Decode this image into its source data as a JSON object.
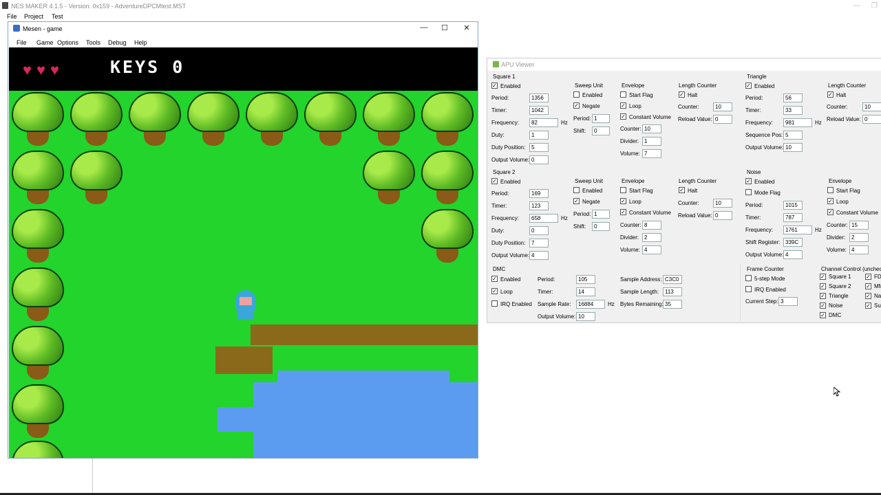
{
  "nesmaker": {
    "title": "NES MAKER 4.1.5 - Version: 0x159 - AdventureDPCMtest.MST",
    "menu": [
      "File",
      "Project",
      "Test"
    ]
  },
  "mesen": {
    "title": "Mesen - game",
    "menu": [
      "File",
      "Game",
      "Options",
      "Tools",
      "Debug",
      "Help"
    ],
    "buttons": {
      "min": "—",
      "max": "☐",
      "close": "✕"
    }
  },
  "game": {
    "hearts": [
      "♥",
      "♥",
      "♥"
    ],
    "keys_text": "KEYS 0"
  },
  "apu": {
    "title": "APU Viewer",
    "sq1": {
      "label": "Square 1",
      "enabled": "Enabled",
      "period_l": "Period:",
      "period": "1356",
      "timer_l": "Timer:",
      "timer": "1042",
      "freq_l": "Frequency:",
      "freq": "82",
      "hz": "Hz",
      "duty_l": "Duty:",
      "duty": "1",
      "dpos_l": "Duty Position:",
      "dpos": "5",
      "ovol_l": "Output Volume:",
      "ovol": "0",
      "sweep": {
        "label": "Sweep Unit",
        "enabled": "Enabled",
        "negate": "Negate",
        "period_l": "Period:",
        "period": "1",
        "shift_l": "Shift:",
        "shift": "0"
      },
      "env": {
        "label": "Envelope",
        "start": "Start Flag",
        "loop": "Loop",
        "const": "Constant Volume",
        "counter_l": "Counter:",
        "counter": "10",
        "divider_l": "Divider:",
        "divider": "1",
        "volume_l": "Volume:",
        "volume": "7"
      },
      "len": {
        "label": "Length Counter",
        "halt": "Halt",
        "counter_l": "Counter:",
        "counter": "10",
        "reload_l": "Reload Value:",
        "reload": "0"
      }
    },
    "sq2": {
      "label": "Square 2",
      "enabled": "Enabled",
      "period_l": "Period:",
      "period": "169",
      "timer_l": "Timer:",
      "timer": "123",
      "freq_l": "Frequency:",
      "freq": "658",
      "hz": "Hz",
      "duty_l": "Duty:",
      "duty": "0",
      "dpos_l": "Duty Position:",
      "dpos": "7",
      "ovol_l": "Output Volume:",
      "ovol": "4",
      "sweep": {
        "label": "Sweep Unit",
        "enabled": "Enabled",
        "negate": "Negate",
        "period_l": "Period:",
        "period": "1",
        "shift_l": "Shift:",
        "shift": "0"
      },
      "env": {
        "label": "Envelope",
        "start": "Start Flag",
        "loop": "Loop",
        "const": "Constant Volume",
        "counter_l": "Counter:",
        "counter": "8",
        "divider_l": "Divider:",
        "divider": "2",
        "volume_l": "Volume:",
        "volume": "4"
      },
      "len": {
        "label": "Length Counter",
        "halt": "Halt",
        "counter_l": "Counter:",
        "counter": "10",
        "reload_l": "Reload Value:",
        "reload": "0"
      }
    },
    "tri": {
      "label": "Triangle",
      "enabled": "Enabled",
      "period_l": "Period:",
      "period": "56",
      "timer_l": "Timer:",
      "timer": "33",
      "freq_l": "Frequency:",
      "freq": "981",
      "hz": "Hz",
      "seq_l": "Sequence Pos:",
      "seq": "5",
      "ovol_l": "Output Volume:",
      "ovol": "10",
      "len": {
        "label": "Length Counter",
        "halt": "Halt",
        "counter_l": "Counter:",
        "counter": "10",
        "reload_l": "Reload Value:",
        "reload": "0"
      }
    },
    "noise": {
      "label": "Noise",
      "enabled": "Enabled",
      "mode": "Mode Flag",
      "period_l": "Period:",
      "period": "1015",
      "timer_l": "Timer:",
      "timer": "787",
      "freq_l": "Frequency:",
      "freq": "1761",
      "hz": "Hz",
      "shift_l": "Shift Register:",
      "shift": "339C",
      "ovol_l": "Output Volume:",
      "ovol": "4",
      "env": {
        "label": "Envelope",
        "start": "Start Flag",
        "loop": "Loop",
        "const": "Constant Volume",
        "counter_l": "Counter:",
        "counter": "15",
        "divider_l": "Divider:",
        "divider": "2",
        "volume_l": "Volume:",
        "volume": "4"
      }
    },
    "dmc": {
      "label": "DMC",
      "enabled": "Enabled",
      "loop": "Loop",
      "irq": "IRQ Enabled",
      "period_l": "Period:",
      "period": "105",
      "timer_l": "Timer:",
      "timer": "14",
      "rate_l": "Sample Rate:",
      "rate": "16884",
      "hz": "Hz",
      "ovol_l": "Output Volume:",
      "ovol": "10",
      "addr_l": "Sample Address:",
      "addr": "C3C0",
      "len_l": "Sample Length:",
      "len": "113",
      "bytes_l": "Bytes Remaining:",
      "bytes": "35"
    },
    "frame": {
      "label": "Frame Counter",
      "five": "5-step Mode",
      "irq": "IRQ Enabled",
      "step_l": "Current Step:",
      "step": "3"
    },
    "chan": {
      "label": "Channel Control (uncheck",
      "items": [
        "Square 1",
        "Square 2",
        "Triangle",
        "Noise",
        "DMC"
      ],
      "items2": [
        "FD",
        "MM",
        "Na",
        "Su"
      ]
    }
  }
}
